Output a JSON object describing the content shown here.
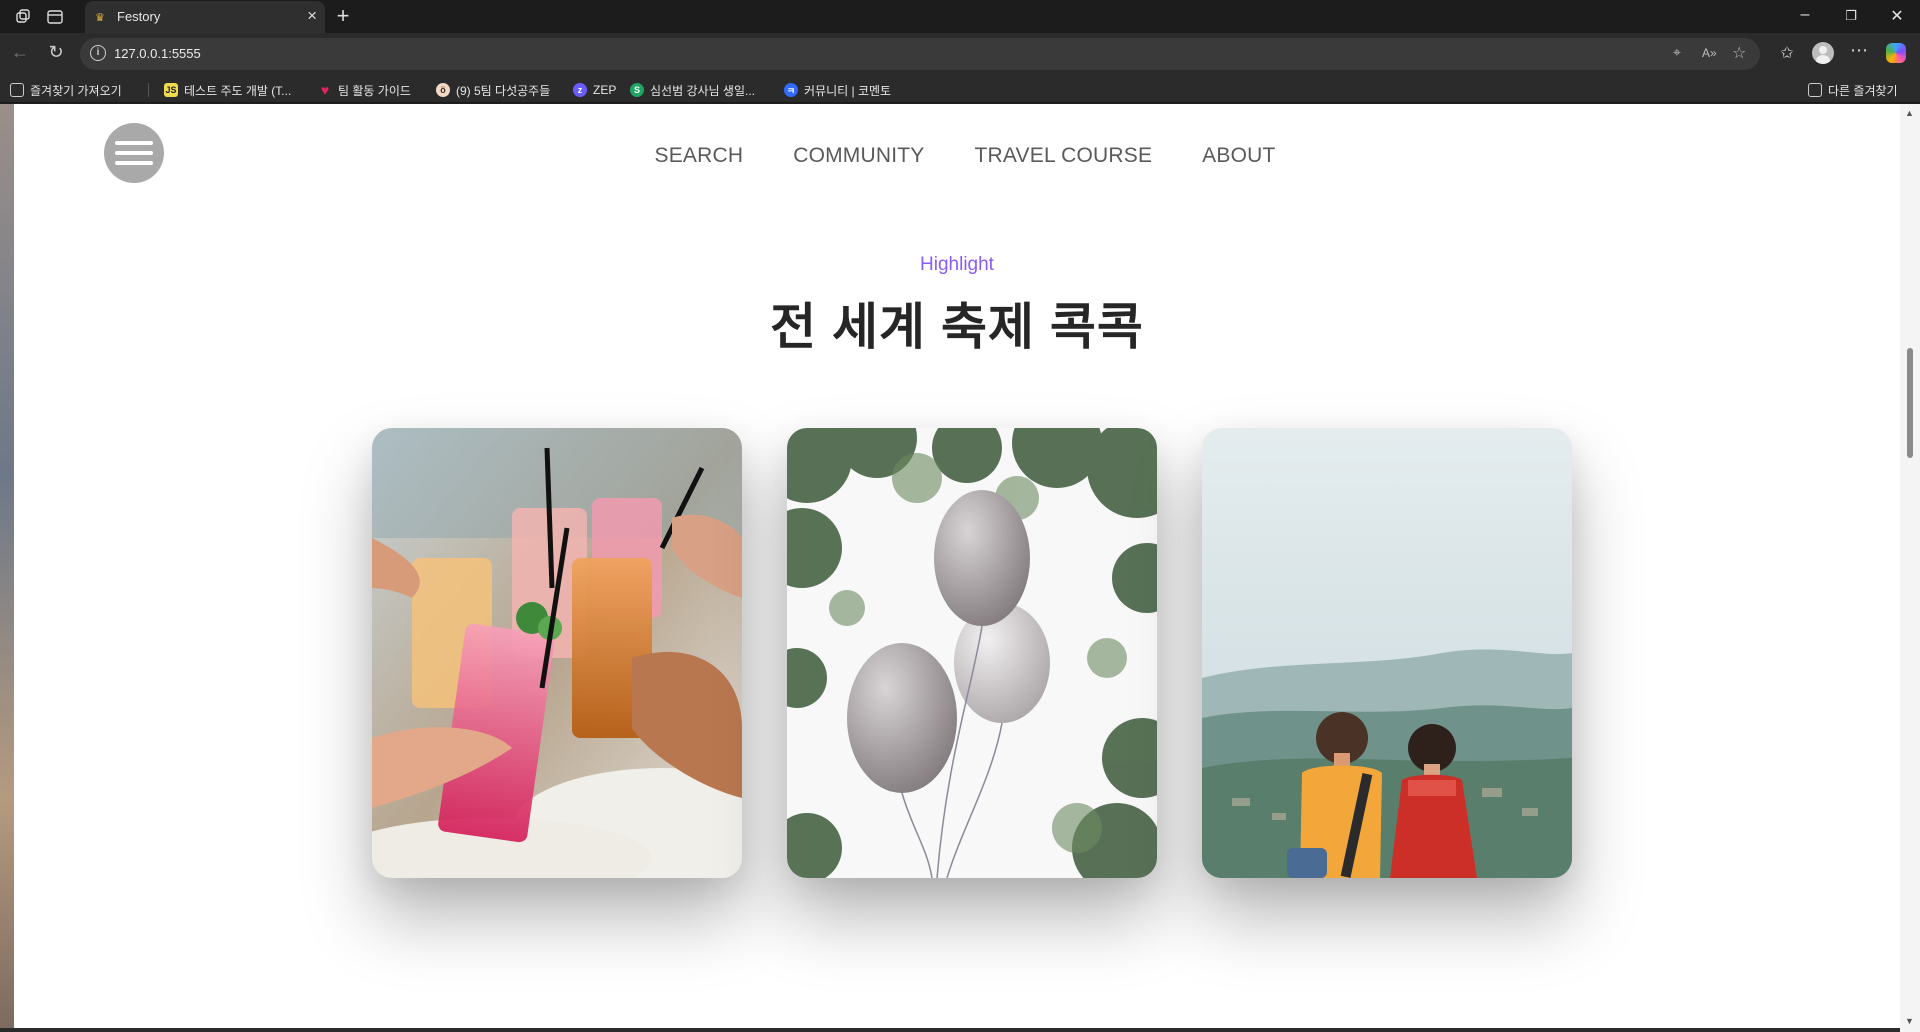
{
  "browser": {
    "tab": {
      "title": "Festory"
    },
    "url": "127.0.0.1:5555",
    "bookmarks": [
      {
        "label": "즐겨찾기 가져오기"
      },
      {
        "label": "테스트 주도 개발 (T..."
      },
      {
        "label": "팀 활동 가이드"
      },
      {
        "label": "(9) 5팀 다섯공주들"
      },
      {
        "label": "ZEP"
      },
      {
        "label": "심선범 강사님 생일..."
      },
      {
        "label": "커뮤니티 | 코멘토"
      }
    ],
    "other_favorites": "다른 즐겨찾기"
  },
  "site": {
    "nav": [
      {
        "label": "SEARCH"
      },
      {
        "label": "COMMUNITY"
      },
      {
        "label": "TRAVEL COURSE"
      },
      {
        "label": "ABOUT"
      }
    ],
    "highlight": {
      "kicker": "Highlight",
      "title": "전 세계 축제 콕콕"
    }
  },
  "colors": {
    "accent": "#8a5cf6",
    "heading": "#262626",
    "nav_text": "#5a5a5a",
    "menu_button": "#a9a9a9"
  }
}
